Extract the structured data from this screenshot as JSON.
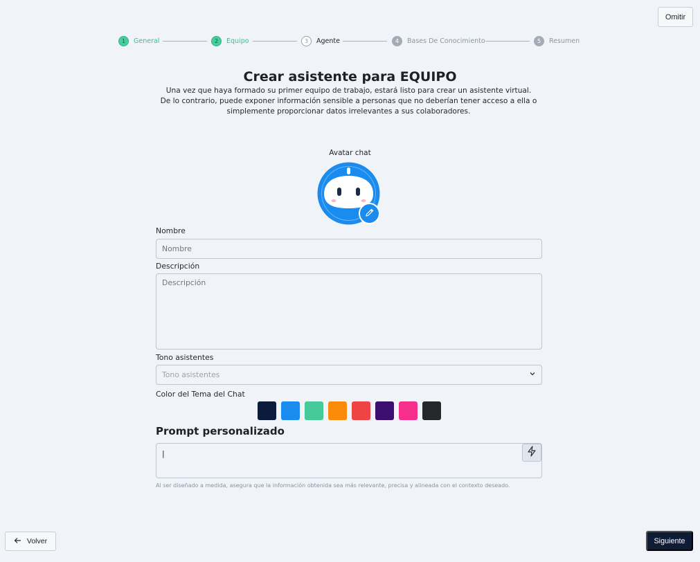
{
  "header": {
    "skip_label": "Omitir"
  },
  "stepper": {
    "steps": [
      {
        "number": "1",
        "label": "General",
        "state": "done"
      },
      {
        "number": "2",
        "label": "Equipo",
        "state": "done"
      },
      {
        "number": "3",
        "label": "Agente",
        "state": "current"
      },
      {
        "number": "4",
        "label": "Bases De Conocimiento",
        "state": "todo"
      },
      {
        "number": "5",
        "label": "Resumen",
        "state": "todo"
      }
    ]
  },
  "main": {
    "title": "Crear asistente para EQUIPO",
    "subtitle": "Una vez que haya formado su primer equipo de trabajo, estará listo para crear un asistente virtual.  De lo contrario, puede exponer información sensible a personas que no deberían tener acceso a ella o simplemente proporcionar datos irrelevantes a sus colaboradores."
  },
  "avatar": {
    "label": "Avatar chat",
    "icon": "robot-avatar-icon",
    "edit_icon": "pencil-icon"
  },
  "form": {
    "name_label": "Nombre",
    "name_placeholder": "Nombre",
    "description_label": "Descripción",
    "description_placeholder": "Descripción",
    "tone_label": "Tono asistentes",
    "tone_placeholder": "Tono asistentes",
    "theme_label": "Color del Tema del Chat",
    "theme_colors": [
      "#0c1a3c",
      "#1a8cf0",
      "#45c99a",
      "#fb8c0a",
      "#ee4444",
      "#3a0f6e",
      "#f72f8c",
      "#25272b"
    ]
  },
  "prompt": {
    "title": "Prompt personalizado",
    "value": "|",
    "hint": "Al ser diseñado a medida, asegura que la información obtenida sea más relevante, precisa y alineada con el contexto deseado."
  },
  "footer": {
    "back_label": "Volver",
    "next_label": "Siguiente"
  },
  "colors": {
    "accent": "#1a8cf0",
    "done": "#48cd9e",
    "primary_dark": "#0f1c36"
  }
}
